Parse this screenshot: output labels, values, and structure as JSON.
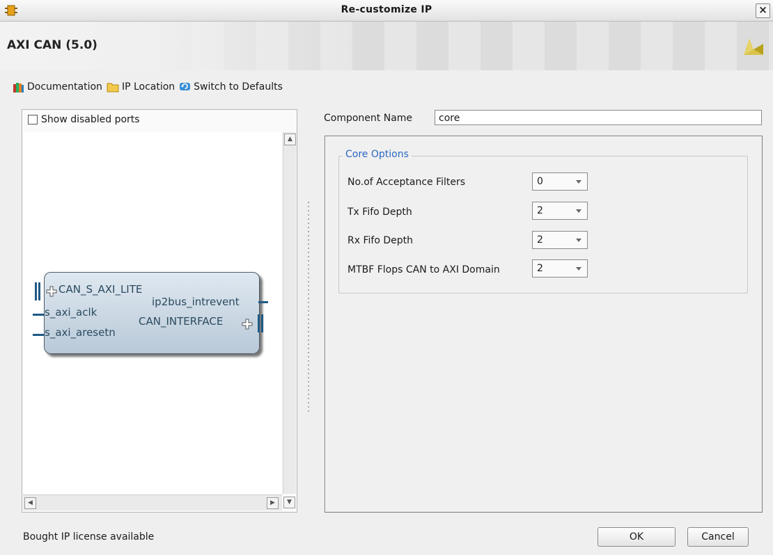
{
  "window": {
    "title": "Re-customize IP"
  },
  "header": {
    "heading": "AXI CAN (5.0)"
  },
  "toolbar": {
    "documentation": "Documentation",
    "ip_location": "IP Location",
    "switch_defaults": "Switch to Defaults"
  },
  "left": {
    "show_disabled_ports": "Show disabled ports",
    "ip_ports": {
      "bus_in": "CAN_S_AXI_LITE",
      "clk": "s_axi_aclk",
      "resetn": "s_axi_aresetn",
      "intr": "ip2bus_intrevent",
      "bus_out": "CAN_INTERFACE"
    }
  },
  "component": {
    "label": "Component Name",
    "value": "core"
  },
  "core_options": {
    "title": "Core Options",
    "rows": [
      {
        "label": "No.of Acceptance Filters",
        "value": "0"
      },
      {
        "label": "Tx Fifo Depth",
        "value": "2"
      },
      {
        "label": "Rx Fifo Depth",
        "value": "2"
      },
      {
        "label": "MTBF Flops CAN to AXI Domain",
        "value": "2"
      }
    ]
  },
  "footer": {
    "status": "Bought IP license available",
    "ok": "OK",
    "cancel": "Cancel"
  },
  "colors": {
    "accent_blue": "#2a67c2",
    "ip_block": "#c9d6e2"
  }
}
